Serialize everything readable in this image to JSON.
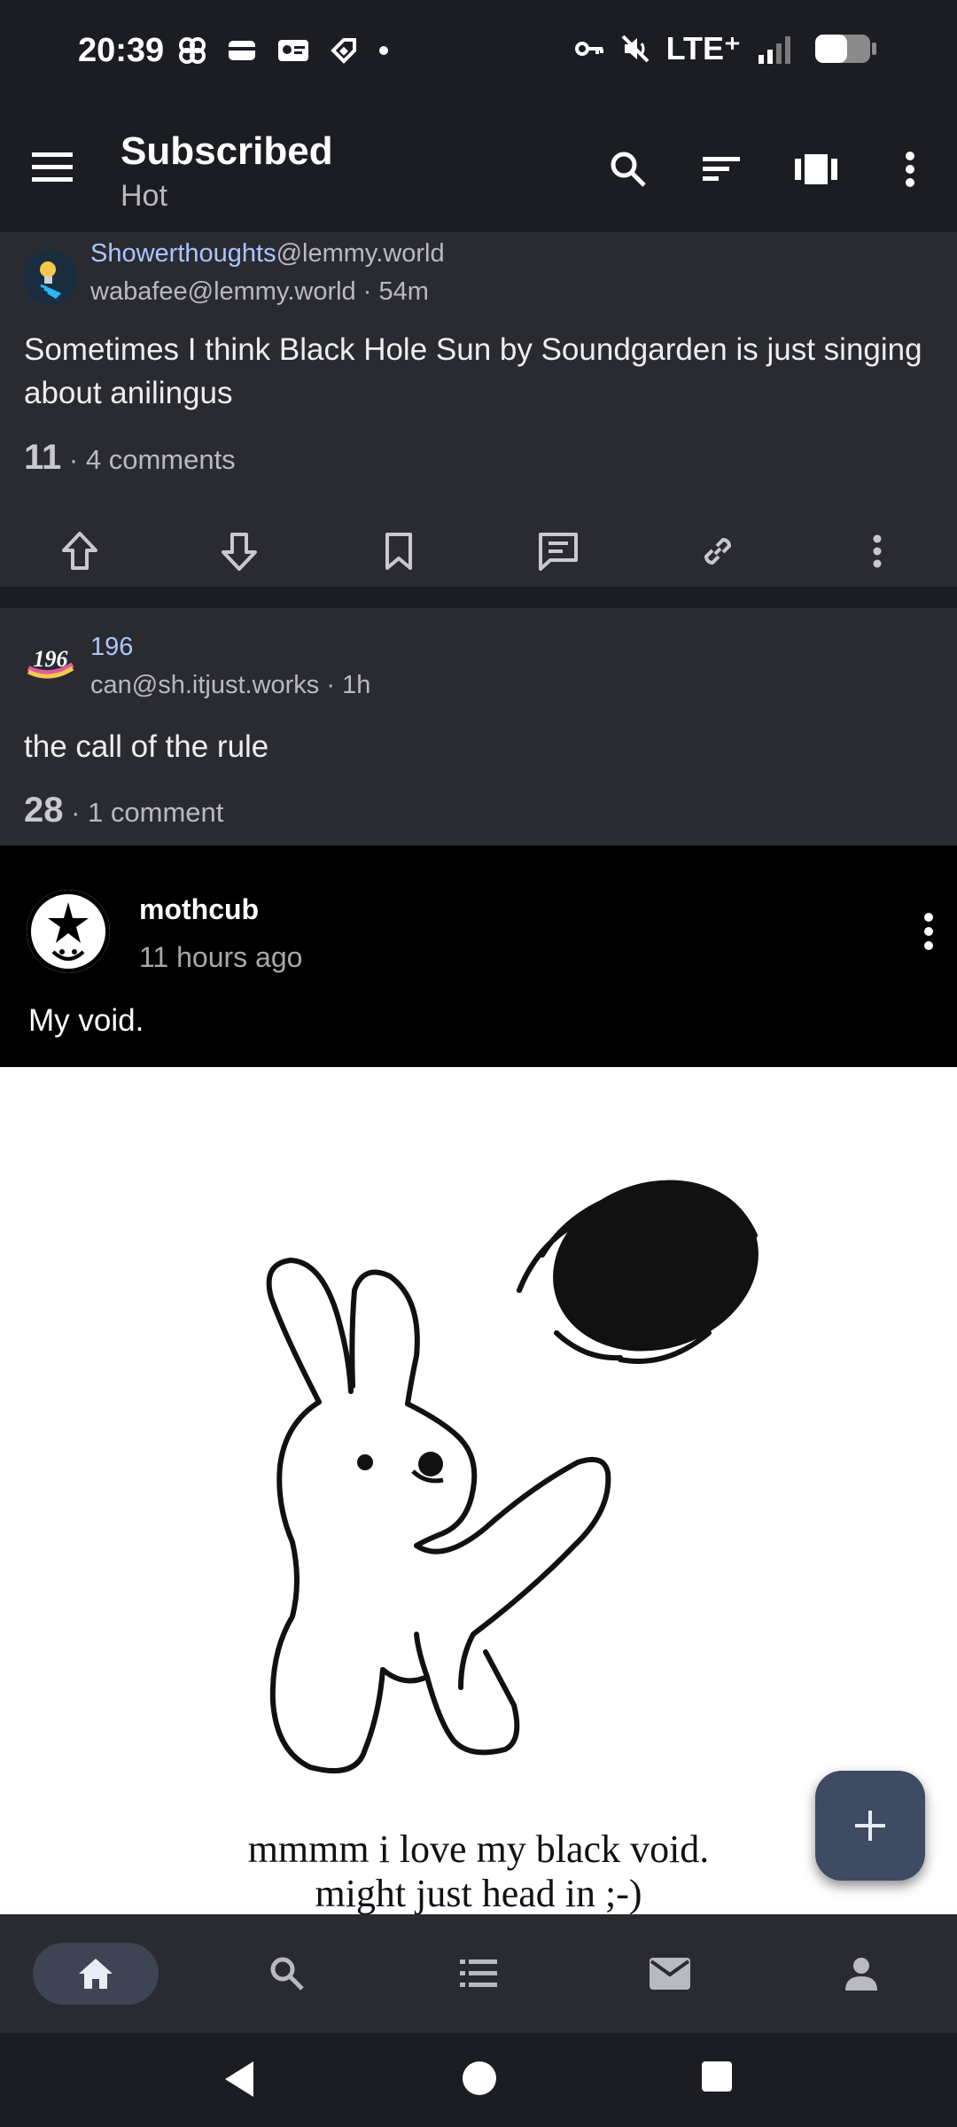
{
  "status_bar": {
    "time": "20:39",
    "network": "LTE⁺",
    "icons": [
      "pinwheel-icon",
      "wallet-icon",
      "id-card-icon",
      "tag-icon",
      "dot-icon",
      "key-icon",
      "mute-icon",
      "signal-icon",
      "battery-icon"
    ]
  },
  "app_bar": {
    "title": "Subscribed",
    "subtitle": "Hot",
    "actions": [
      "search-icon",
      "sort-icon",
      "view-carousel-icon",
      "more-vertical-icon"
    ]
  },
  "posts": [
    {
      "community": "Showerthoughts",
      "instance": "@lemmy.world",
      "author": "wabafee@lemmy.world · 54m",
      "title": "Sometimes I think Black Hole Sun by Soundgarden is just singing about anilingus",
      "score": "11",
      "comments": " · 4 comments",
      "actions": [
        "upvote-icon",
        "downvote-icon",
        "bookmark-icon",
        "reply-icon",
        "link-icon",
        "more-vertical-icon"
      ]
    },
    {
      "community": "196",
      "author": "can@sh.itjust.works · 1h",
      "title": "the call of the rule",
      "score": "28",
      "comments": " · 1 comment"
    }
  ],
  "embedded_post": {
    "username": "mothcub",
    "time": "11 hours ago",
    "text": "My void.",
    "caption_line1": "mmmm i love my black void.",
    "caption_line2": "might just head in ;-)"
  },
  "fab": {
    "icon": "plus-icon"
  },
  "bottom_nav": [
    "home-icon",
    "search-icon",
    "list-icon",
    "mail-icon",
    "person-icon"
  ],
  "colors": {
    "background": "#1c1d22",
    "card": "#2a2b31",
    "community_link": "#a9c6ff",
    "fab": "#3f4a63",
    "nav_pill": "#3e4453"
  }
}
